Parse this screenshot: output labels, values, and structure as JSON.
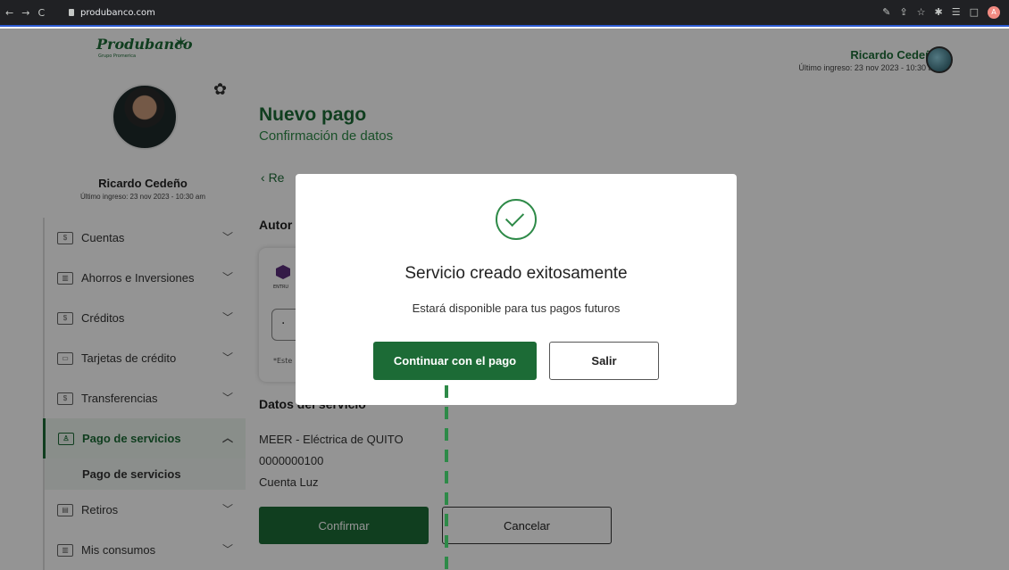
{
  "browser": {
    "url": "produbanco.com",
    "profile_initial": "A"
  },
  "brand": {
    "name": "Produbanco",
    "sub": "Grupo Promerica"
  },
  "sidebar": {
    "user_name": "Ricardo Cedeño",
    "last_login": "Último ingreso: 23 nov 2023 - 10:30 am",
    "items": [
      {
        "label": "Cuentas"
      },
      {
        "label": "Ahorros e Inversiones"
      },
      {
        "label": "Créditos"
      },
      {
        "label": "Tarjetas de crédito"
      },
      {
        "label": "Transferencias"
      },
      {
        "label": "Pago de servicios"
      },
      {
        "label": "Retiros"
      },
      {
        "label": "Mis consumos"
      }
    ],
    "subitem": "Pago de servicios"
  },
  "header": {
    "user_name": "Ricardo Cedeño",
    "last_login": "Último ingreso: 23 nov 2023 - 10:30 am"
  },
  "main": {
    "title": "Nuevo pago",
    "subtitle": "Confirmación de datos",
    "back_label": "Re",
    "auth_title": "Autor",
    "card_brand": "ENTRU",
    "card_field": "·",
    "card_note": "*Este",
    "datos_title": "Datos del servicio",
    "datos": [
      "MEER - Eléctrica de QUITO",
      "0000000100",
      "Cuenta Luz"
    ],
    "confirm_label": "Confirmar",
    "cancel_label": "Cancelar"
  },
  "modal": {
    "title": "Servicio creado exitosamente",
    "message": "Estará disponible para tus pagos futuros",
    "continue_label": "Continuar con el pago",
    "exit_label": "Salir"
  },
  "colors": {
    "brand_green": "#1c6b36",
    "accent_green": "#2e8a48"
  }
}
